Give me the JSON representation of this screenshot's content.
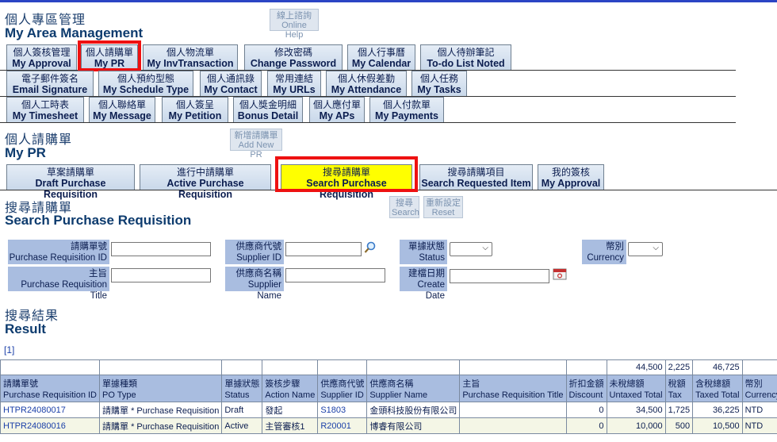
{
  "header": {
    "title_cn": "個人專區管理",
    "title_en": "My Area Management",
    "online_help_cn": "線上諮詢",
    "online_help_en": "Online Help"
  },
  "main_tabs_row1": [
    {
      "cn": "個人簽核管理",
      "en": "My Approval"
    },
    {
      "cn": "個人請購單",
      "en": "My PR"
    },
    {
      "cn": "個人物流單",
      "en": "My InvTransaction"
    },
    {
      "cn": "修改密碼",
      "en": "Change Password"
    },
    {
      "cn": "個人行事曆",
      "en": "My Calendar"
    },
    {
      "cn": "個人待辦筆記",
      "en": "To-do List Noted"
    }
  ],
  "main_tabs_row2": [
    {
      "cn": "電子郵件簽名",
      "en": "Email Signature"
    },
    {
      "cn": "個人預約型態",
      "en": "My Schedule Type"
    },
    {
      "cn": "個人通訊錄",
      "en": "My Contact"
    },
    {
      "cn": "常用連結",
      "en": "My URLs"
    },
    {
      "cn": "個人休假差勤",
      "en": "My Attendance"
    },
    {
      "cn": "個人任務",
      "en": "My Tasks"
    }
  ],
  "main_tabs_row3": [
    {
      "cn": "個人工時表",
      "en": "My Timesheet"
    },
    {
      "cn": "個人聯絡單",
      "en": "My Message"
    },
    {
      "cn": "個人簽呈",
      "en": "My Petition"
    },
    {
      "cn": "個人獎金明細",
      "en": "Bonus Detail"
    },
    {
      "cn": "個人應付單",
      "en": "My APs"
    },
    {
      "cn": "個人付款單",
      "en": "My Payments"
    }
  ],
  "pr_section": {
    "title_cn": "個人請購單",
    "title_en": "My PR",
    "add_new_cn": "新增請購單",
    "add_new_en": "Add New PR"
  },
  "pr_tabs": [
    {
      "cn": "草案請購單",
      "en": "Draft Purchase Requisition"
    },
    {
      "cn": "進行中請購單",
      "en": "Active Purchase Requisition"
    },
    {
      "cn": "搜尋請購單",
      "en": "Search Purchase Requisition"
    },
    {
      "cn": "搜尋請購項目",
      "en": "Search Requested Item"
    },
    {
      "cn": "我的簽核",
      "en": "My Approval"
    }
  ],
  "search": {
    "title_cn": "搜尋請購單",
    "title_en": "Search Purchase Requisition",
    "search_cn": "搜尋",
    "search_en": "Search",
    "reset_cn": "重新設定",
    "reset_en": "Reset",
    "fields": {
      "pr_id_cn": "請購單號",
      "pr_id_en": "Purchase Requisition ID",
      "pr_title_cn": "主旨",
      "pr_title_en": "Purchase Requisition Title",
      "supplier_id_cn": "供應商代號",
      "supplier_id_en": "Supplier ID",
      "supplier_name_cn": "供應商名稱",
      "supplier_name_en": "Supplier Name",
      "status_cn": "單據狀態",
      "status_en": "Status",
      "create_date_cn": "建檔日期",
      "create_date_en": "Create Date",
      "currency_cn": "幣別",
      "currency_en": "Currency"
    }
  },
  "result": {
    "title_cn": "搜尋結果",
    "title_en": "Result",
    "pager": "[1]",
    "totals": {
      "untaxed": "44,500",
      "tax": "2,225",
      "taxed": "46,725"
    },
    "columns": [
      {
        "cn": "請購單號",
        "en": "Purchase Requisition ID"
      },
      {
        "cn": "單據種類",
        "en": "PO Type"
      },
      {
        "cn": "單據狀態",
        "en": "Status"
      },
      {
        "cn": "簽核步驟",
        "en": "Action Name"
      },
      {
        "cn": "供應商代號",
        "en": "Supplier ID"
      },
      {
        "cn": "供應商名稱",
        "en": "Supplier Name"
      },
      {
        "cn": "主旨",
        "en": "Purchase Requisition Title"
      },
      {
        "cn": "折扣金額",
        "en": "Discount"
      },
      {
        "cn": "未稅總額",
        "en": "Untaxed Total"
      },
      {
        "cn": "稅額",
        "en": "Tax"
      },
      {
        "cn": "含稅總額",
        "en": "Taxed Total"
      },
      {
        "cn": "幣別",
        "en": "Currency Type"
      }
    ],
    "rows": [
      {
        "id": "HTPR24080017",
        "type": "請購單 * Purchase Requisition",
        "status": "Draft",
        "action": "發起",
        "supplier_id": "S1803",
        "supplier_name": "金頭科技股份有限公司",
        "title": "",
        "discount": "0",
        "untaxed": "34,500",
        "tax": "1,725",
        "taxed": "36,225",
        "currency": "NTD"
      },
      {
        "id": "HTPR24080016",
        "type": "請購單 * Purchase Requisition",
        "status": "Active",
        "action": "主管審核1",
        "supplier_id": "R20001",
        "supplier_name": "博睿有限公司",
        "title": "",
        "discount": "0",
        "untaxed": "10,000",
        "tax": "500",
        "taxed": "10,500",
        "currency": "NTD"
      }
    ]
  }
}
